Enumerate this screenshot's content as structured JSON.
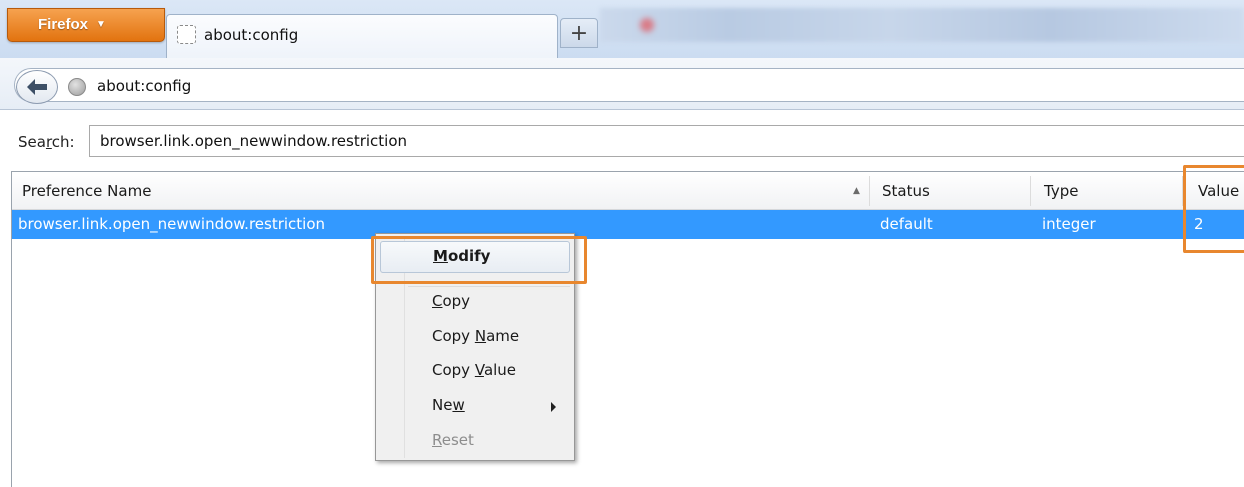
{
  "browser": {
    "menu_button_label": "Firefox",
    "tab_title": "about:config",
    "new_tab_symbol": "+",
    "url": "about:config"
  },
  "search": {
    "label": "Search:",
    "value": "browser.link.open_newwindow.restriction"
  },
  "table": {
    "columns": [
      "Preference Name",
      "Status",
      "Type",
      "Value"
    ],
    "sorted_column": "Preference Name",
    "rows": [
      {
        "name": "browser.link.open_newwindow.restriction",
        "status": "default",
        "type": "integer",
        "value": "2",
        "selected": true
      }
    ]
  },
  "context_menu": {
    "items": [
      {
        "label": "Modify",
        "highlighted": true
      },
      {
        "label": "Copy"
      },
      {
        "label": "Copy Name"
      },
      {
        "label": "Copy Value"
      },
      {
        "label": "New",
        "submenu": true
      },
      {
        "label": "Reset",
        "disabled": true
      }
    ]
  },
  "icons": [
    "firefox-menu-caret-icon",
    "blank-page-icon",
    "new-tab-icon",
    "back-arrow-icon",
    "globe-icon",
    "sort-ascending-icon",
    "submenu-arrow-icon"
  ],
  "colors": {
    "firefox_button": "#e8841e",
    "selection": "#3399ff",
    "annotation": "#e8872e"
  }
}
